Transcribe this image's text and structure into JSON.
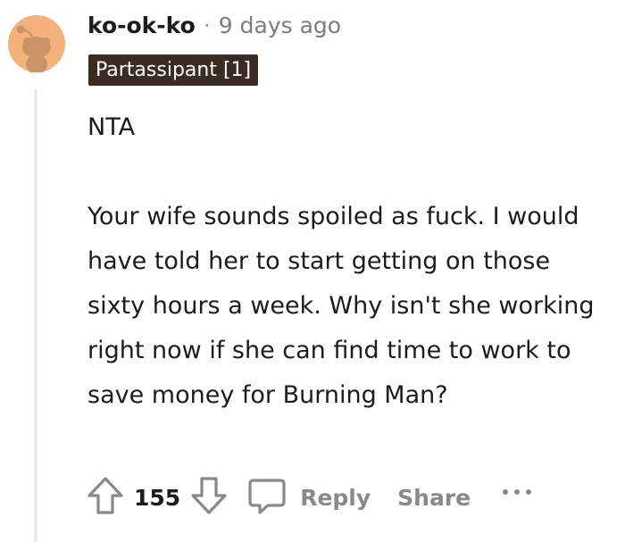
{
  "comment": {
    "username": "ko-ok-ko",
    "separator": "·",
    "timestamp": "9 days ago",
    "flair": "Partassipant [1]",
    "paragraphs": [
      "NTA",
      "Your wife sounds spoiled as fuck. I would have told her to start getting on those sixty hours a week. Why isn't she working right now if she can find time to work to save money for Burning Man?"
    ],
    "score": "155"
  },
  "actions": {
    "reply_label": "Reply",
    "share_label": "Share"
  },
  "icons": {
    "avatar": "snoo-avatar-icon",
    "upvote": "arrow-up-icon",
    "downvote": "arrow-down-icon",
    "reply": "speech-bubble-icon",
    "more": "ellipsis-icon"
  },
  "colors": {
    "avatar_background": "#f4b27a",
    "flair_background": "#3b2b22",
    "muted_text": "#878a8c",
    "thread_line": "#ebebeb"
  }
}
